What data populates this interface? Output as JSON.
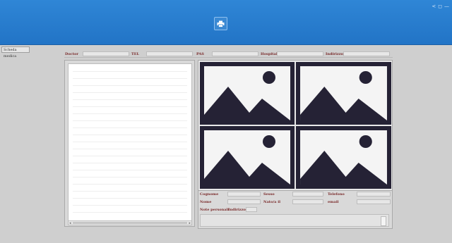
{
  "app": {
    "window_controls": [
      "<",
      "◻",
      "—"
    ],
    "left_tab_label": "Scheda medica"
  },
  "header": {
    "doctor_label": "Doctor",
    "tel_label": "TEL",
    "pas_label": "PAS",
    "hospital_label": "Hospital",
    "address_label": "Indirizzo"
  },
  "patient": {
    "cognome_label": "Cognome",
    "sesso_label": "Sesso",
    "telefono_label": "Telefono",
    "nome_label": "Nome",
    "nato_label": "Nato/a il",
    "email_label": "email",
    "note_label": "Note personali",
    "indirizzo_label": "Indirizzo"
  },
  "icons": {
    "print": "printer-icon",
    "image_placeholder": "image-placeholder-icon"
  },
  "colors": {
    "titlebar": "#2274c6",
    "label_text": "#7a2a2a",
    "image_dark": "#252235"
  }
}
